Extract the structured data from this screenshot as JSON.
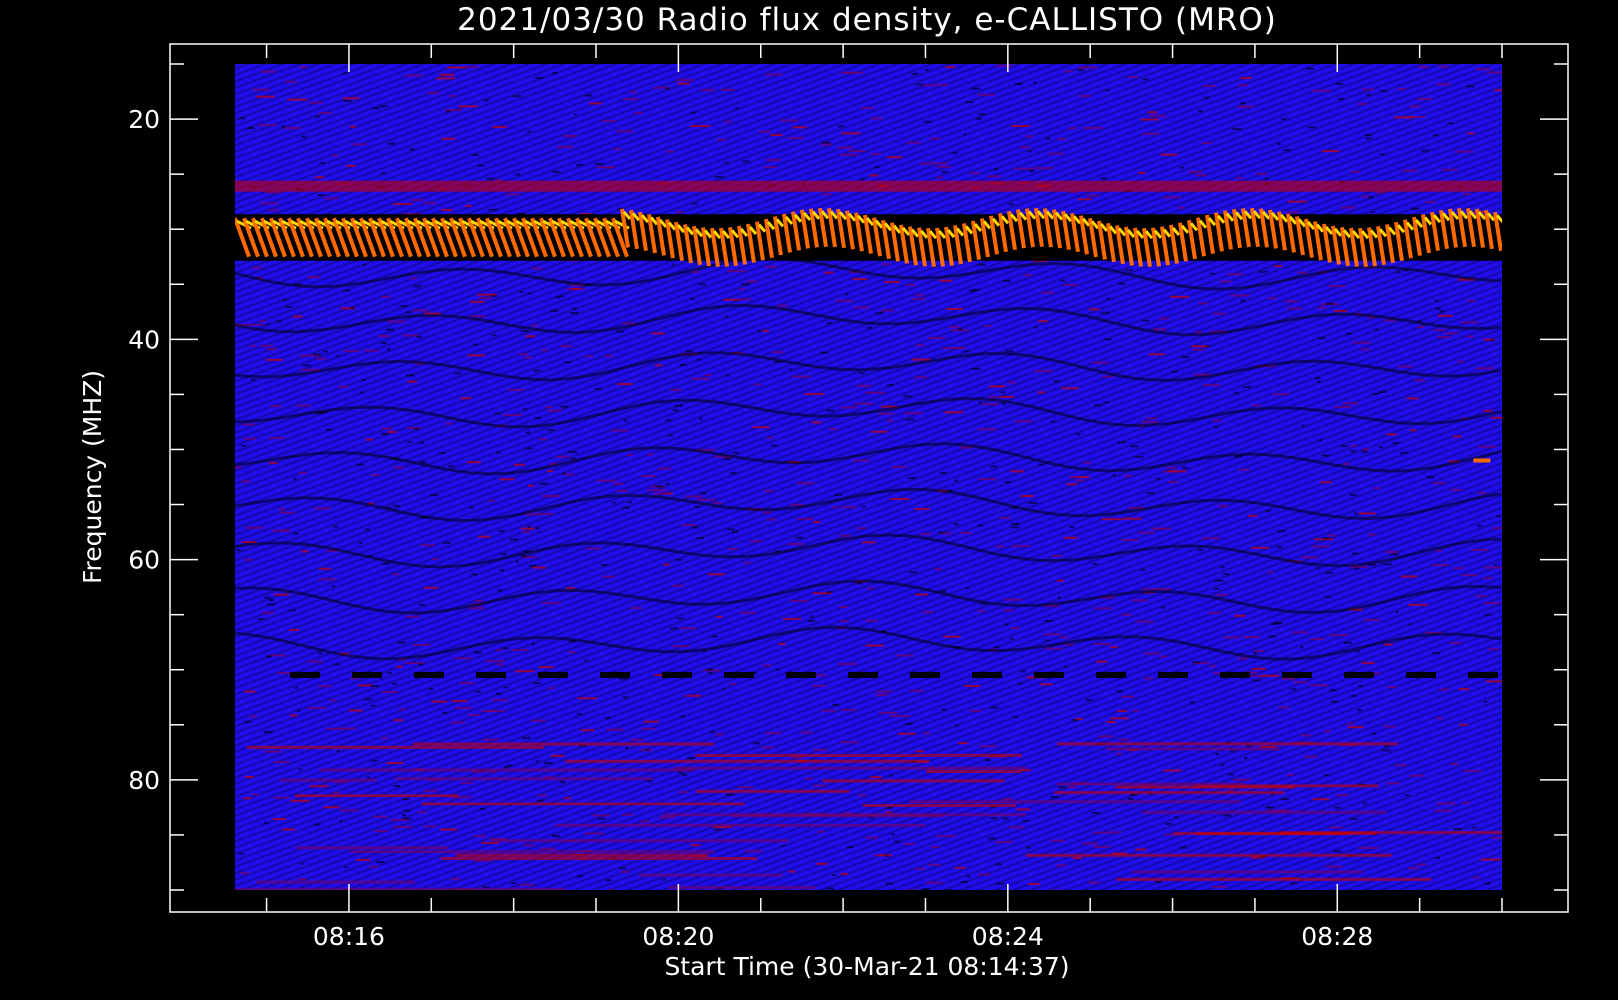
{
  "chart_data": {
    "type": "heatmap",
    "title": "2021/03/30  Radio flux density, e-CALLISTO (MRO)",
    "xlabel": "Start Time (30-Mar-21 08:14:37)",
    "ylabel": "Frequency (MHZ)",
    "x_range_minutes": [
      "08:14:37",
      "08:30:00"
    ],
    "y_range_mhz": [
      15,
      90
    ],
    "y_inverted": true,
    "x_ticks": [
      "08:16",
      "08:20",
      "08:24",
      "08:28"
    ],
    "y_ticks": [
      20,
      40,
      60,
      80
    ],
    "colormap": [
      "#000000",
      "#1a00d8",
      "#2a10ff",
      "#7a0060",
      "#c80000",
      "#ff6a00",
      "#ffd800"
    ],
    "features": [
      {
        "name": "strong interference band",
        "freq_mhz": [
          29,
          32
        ],
        "intensity": "high"
      },
      {
        "name": "secondary band",
        "freq_mhz": [
          25,
          27
        ],
        "intensity": "medium"
      },
      {
        "name": "dropout line",
        "freq_mhz": [
          70,
          71
        ],
        "intensity": "low"
      },
      {
        "name": "spot",
        "time": "08:29:45",
        "freq_mhz": 51,
        "intensity": "high"
      }
    ]
  }
}
